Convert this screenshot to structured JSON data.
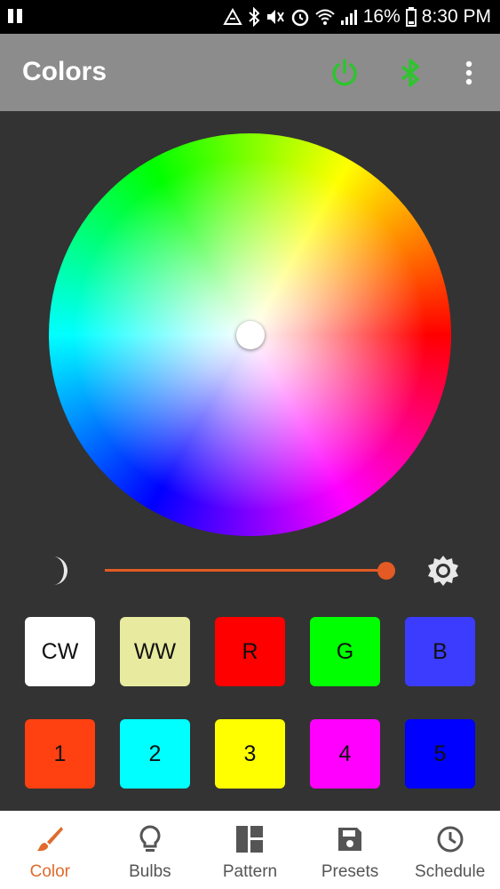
{
  "status_bar": {
    "battery": "16%",
    "time": "8:30 PM"
  },
  "app_bar": {
    "title": "Colors",
    "accent_color": "#2ec42e"
  },
  "color_wheel": {
    "selected": "center"
  },
  "brightness": {
    "value_fraction": 0.96,
    "color": "#e35a24"
  },
  "presets": {
    "row1": [
      {
        "label": "CW",
        "color": "#ffffff"
      },
      {
        "label": "WW",
        "color": "#e8eaa0"
      },
      {
        "label": "R",
        "color": "#ff0000"
      },
      {
        "label": "G",
        "color": "#00ff00"
      },
      {
        "label": "B",
        "color": "#3c3cff"
      }
    ],
    "row2": [
      {
        "label": "1",
        "color": "#ff4010"
      },
      {
        "label": "2",
        "color": "#00ffff"
      },
      {
        "label": "3",
        "color": "#ffff00"
      },
      {
        "label": "4",
        "color": "#ff00ff"
      },
      {
        "label": "5",
        "color": "#0000ff"
      }
    ]
  },
  "bottom_nav": {
    "active_color": "#e06a2c",
    "items": [
      {
        "label": "Color",
        "icon": "brush-icon"
      },
      {
        "label": "Bulbs",
        "icon": "bulb-icon"
      },
      {
        "label": "Pattern",
        "icon": "pattern-icon"
      },
      {
        "label": "Presets",
        "icon": "save-icon"
      },
      {
        "label": "Schedule",
        "icon": "clock-icon"
      }
    ]
  }
}
